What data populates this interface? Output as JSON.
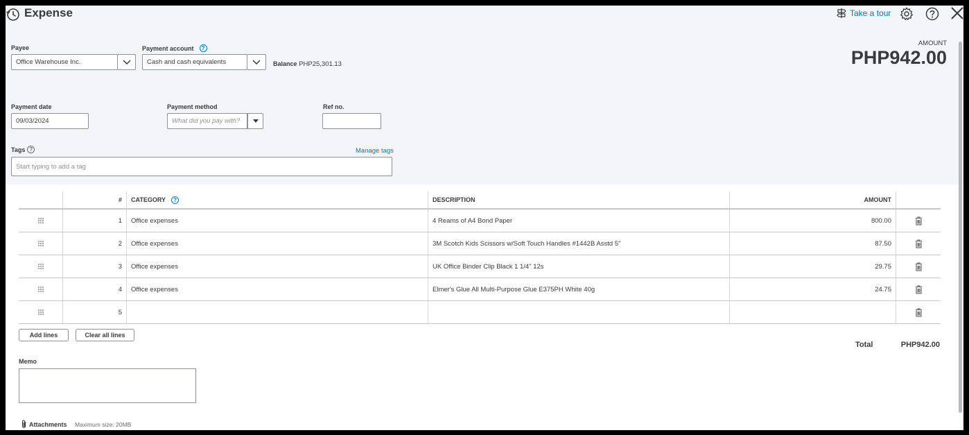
{
  "header": {
    "title": "Expense",
    "tour_label": "Take a tour"
  },
  "payee": {
    "label": "Payee",
    "value": "Office Warehouse Inc."
  },
  "payment_account": {
    "label": "Payment account",
    "value": "Cash and cash equivalents",
    "balance_label": "Balance",
    "balance_value": "PHP25,301.13"
  },
  "amount": {
    "label": "AMOUNT",
    "value": "PHP942.00"
  },
  "payment_date": {
    "label": "Payment date",
    "value": "09/03/2024"
  },
  "payment_method": {
    "label": "Payment method",
    "placeholder": "What did you pay with?"
  },
  "ref_no": {
    "label": "Ref no.",
    "value": ""
  },
  "tags": {
    "label": "Tags",
    "placeholder": "Start typing to add a tag",
    "manage_label": "Manage tags"
  },
  "table": {
    "headers": {
      "num": "#",
      "category": "CATEGORY",
      "description": "DESCRIPTION",
      "amount": "AMOUNT"
    },
    "rows": [
      {
        "num": "1",
        "category": "Office expenses",
        "description": "4 Reams of A4 Bond Paper",
        "amount": "800.00"
      },
      {
        "num": "2",
        "category": "Office expenses",
        "description": "3M Scotch Kids Scissors w/Soft Touch Handles #1442B Asstd 5\"",
        "amount": "87.50"
      },
      {
        "num": "3",
        "category": "Office expenses",
        "description": "UK Office Binder Clip Black 1 1/4\" 12s",
        "amount": "29.75"
      },
      {
        "num": "4",
        "category": "Office expenses",
        "description": "Elmer's Glue All Multi-Purpose Glue E375PH White 40g",
        "amount": "24.75"
      },
      {
        "num": "5",
        "category": "",
        "description": "",
        "amount": ""
      }
    ]
  },
  "actions": {
    "add_lines": "Add lines",
    "clear_all_lines": "Clear all lines"
  },
  "total": {
    "label": "Total",
    "value": "PHP942.00"
  },
  "memo": {
    "label": "Memo",
    "value": ""
  },
  "attachments": {
    "label": "Attachments",
    "max_size": "Maximum size: 20MB"
  },
  "colors": {
    "link": "#0077c5",
    "text": "#393a3d",
    "header_bg": "#f4f5f8"
  }
}
